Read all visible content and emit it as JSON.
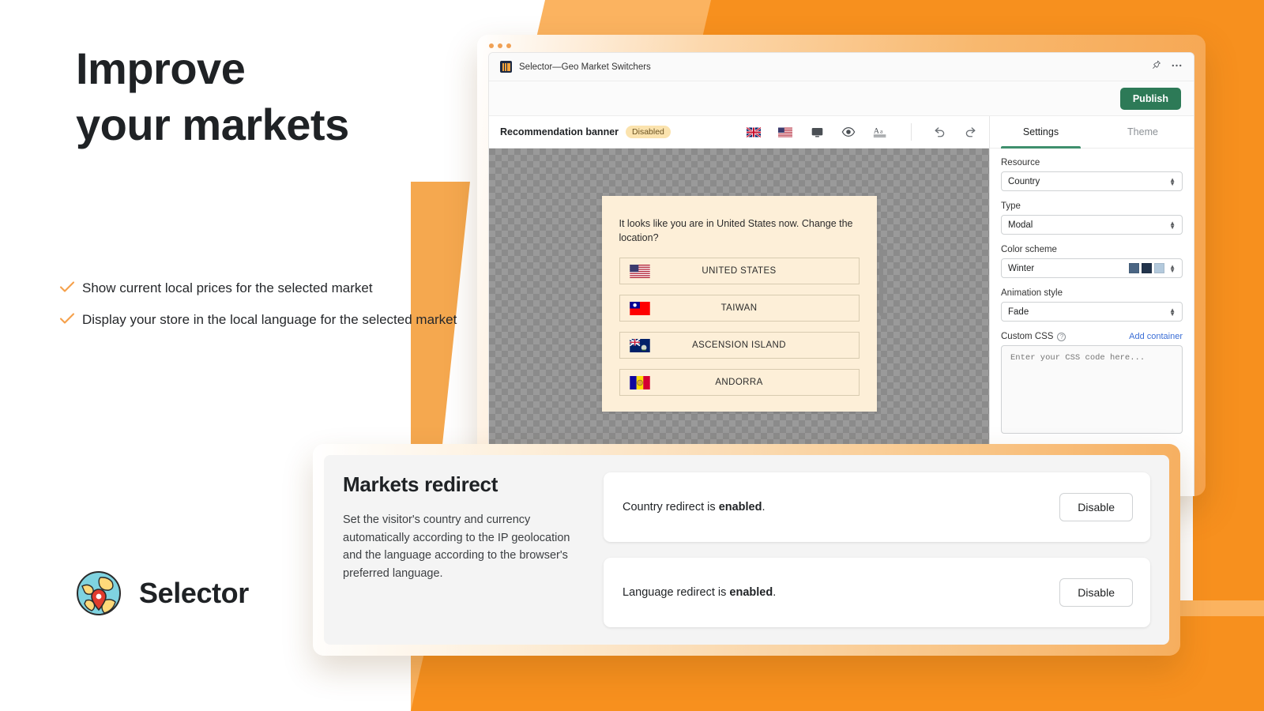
{
  "hero": {
    "headline_line1": "Improve",
    "headline_line2": "your markets",
    "bullets": [
      "Show current local prices for the selected market",
      "Display your store in the local language for the selected market"
    ],
    "brand_name": "Selector",
    "check_color": "#f5a04a",
    "accent_orange": "#f7901e",
    "accent_orange_light": "#fbb360"
  },
  "app_window": {
    "title": "Selector—Geo Market Switchers",
    "pin_icon": "pushpin-icon",
    "more_icon": "more-horizontal-icon",
    "publish_label": "Publish",
    "publish_color": "#2d7a57"
  },
  "editor": {
    "section_title": "Recommendation banner",
    "status_badge": "Disabled",
    "toolbar_icons": [
      "uk-flag-icon",
      "us-flag-icon",
      "desktop-preview-icon",
      "eye-preview-icon",
      "typography-icon",
      "undo-icon",
      "redo-icon"
    ]
  },
  "preview": {
    "modal_prompt": "It looks like you are in United States now. Change the location?",
    "countries": [
      {
        "name": "UNITED STATES",
        "flag": "us-flag-icon"
      },
      {
        "name": "TAIWAN",
        "flag": "taiwan-flag-icon"
      },
      {
        "name": "ASCENSION ISLAND",
        "flag": "ascension-island-flag-icon"
      },
      {
        "name": "ANDORRA",
        "flag": "andorra-flag-icon"
      }
    ]
  },
  "settings": {
    "tabs": [
      {
        "label": "Settings",
        "active": true
      },
      {
        "label": "Theme",
        "active": false
      }
    ],
    "fields": [
      {
        "label": "Resource",
        "value": "Country"
      },
      {
        "label": "Type",
        "value": "Modal"
      },
      {
        "label": "Color scheme",
        "value": "Winter"
      },
      {
        "label": "Animation style",
        "value": "Fade"
      }
    ],
    "color_swatches": [
      "#4a6583",
      "#22344c",
      "#b3c9dc"
    ],
    "custom_css": {
      "label": "Custom CSS",
      "help_icon": "question-mark-icon",
      "add_container_label": "Add container",
      "placeholder": "Enter your CSS code here...",
      "value": ""
    }
  },
  "markets_redirect": {
    "title": "Markets redirect",
    "description": "Set the visitor's country and currency automatically according to the IP geolocation and the language according to the browser's preferred language.",
    "rows": [
      {
        "prefix": "Country redirect is ",
        "state": "enabled",
        "suffix": ".",
        "button": "Disable"
      },
      {
        "prefix": "Language redirect is ",
        "state": "enabled",
        "suffix": ".",
        "button": "Disable"
      }
    ]
  }
}
